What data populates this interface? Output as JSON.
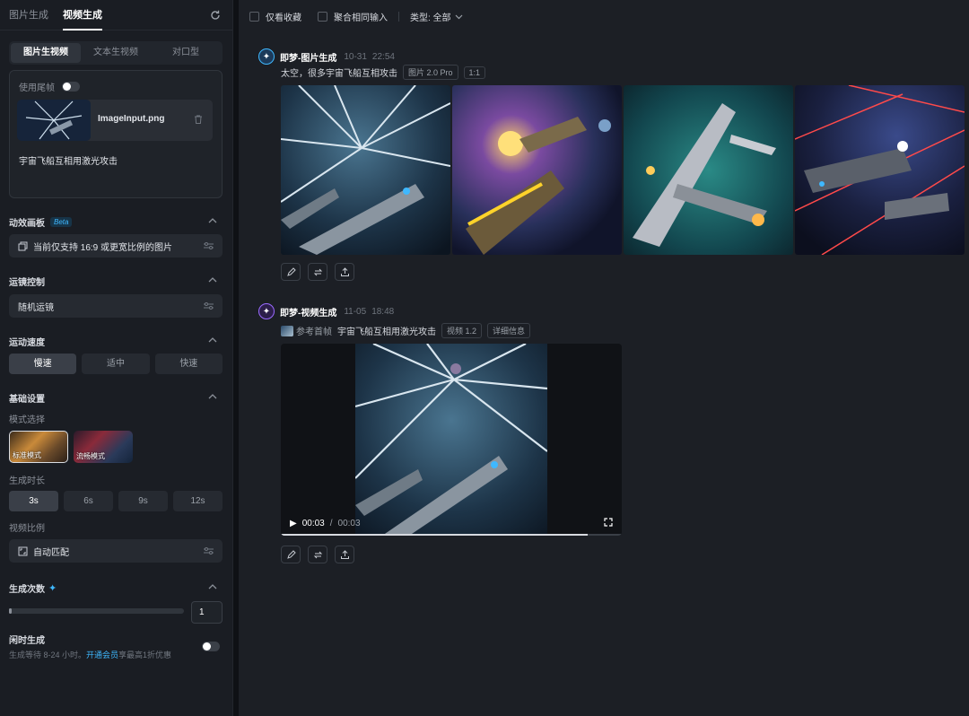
{
  "left": {
    "tabs": [
      "图片生成",
      "视频生成"
    ],
    "active_tab": 1,
    "gen_modes": [
      "图片生视频",
      "文本生视频",
      "对口型"
    ],
    "tail_frame_label": "使用尾帧",
    "tail_frame_enabled": false,
    "file_name": "ImageInput.png",
    "prompt": "宇宙飞船互相用激光攻击",
    "effects_title": "动效画板",
    "beta": "Beta",
    "effects_note": "当前仅支持 16:9 或更宽比例的图片",
    "camera_title": "运镜控制",
    "camera_value": "随机运镜",
    "speed_title": "运动速度",
    "speeds": [
      "慢速",
      "适中",
      "快速"
    ],
    "speed_selected": 0,
    "basic_title": "基础设置",
    "model_label": "模式选择",
    "models": [
      "标准模式",
      "流畅模式"
    ],
    "duration_label": "生成时长",
    "durations": [
      "3s",
      "6s",
      "9s",
      "12s"
    ],
    "duration_selected": 0,
    "ratio_label": "视频比例",
    "ratio_value": "自动匹配",
    "count_title": "生成次数",
    "count_value": "1",
    "count_fraction": 0.0,
    "idle_title": "闲时生成",
    "idle_note_prefix": "生成等待 8-24 小时。",
    "idle_note_link": "开通会员",
    "idle_note_suffix": "享最高1折优惠",
    "idle_enabled": false
  },
  "right": {
    "filter_fav": "仅看收藏",
    "filter_merge": "聚合相同输入",
    "filter_type": "类型: 全部",
    "msg1": {
      "name": "即梦-图片生成",
      "date": "10-31",
      "time": "22:54",
      "prompt": "太空，很多宇宙飞船互相攻击",
      "model": "图片 2.0 Pro",
      "ratio": "1:1"
    },
    "msg2": {
      "name": "即梦-视频生成",
      "date": "11-05",
      "time": "18:48",
      "ref": "参考首帧",
      "prompt": "宇宙飞船互相用激光攻击",
      "model": "视频 1.2",
      "detail": "详细信息",
      "current": "00:03",
      "sep": "/",
      "duration": "00:03",
      "progress": 0.9
    }
  },
  "colors": {
    "accent": "#3fb8ff",
    "bg": "#1c1f25",
    "panel": "#1a1d23"
  }
}
